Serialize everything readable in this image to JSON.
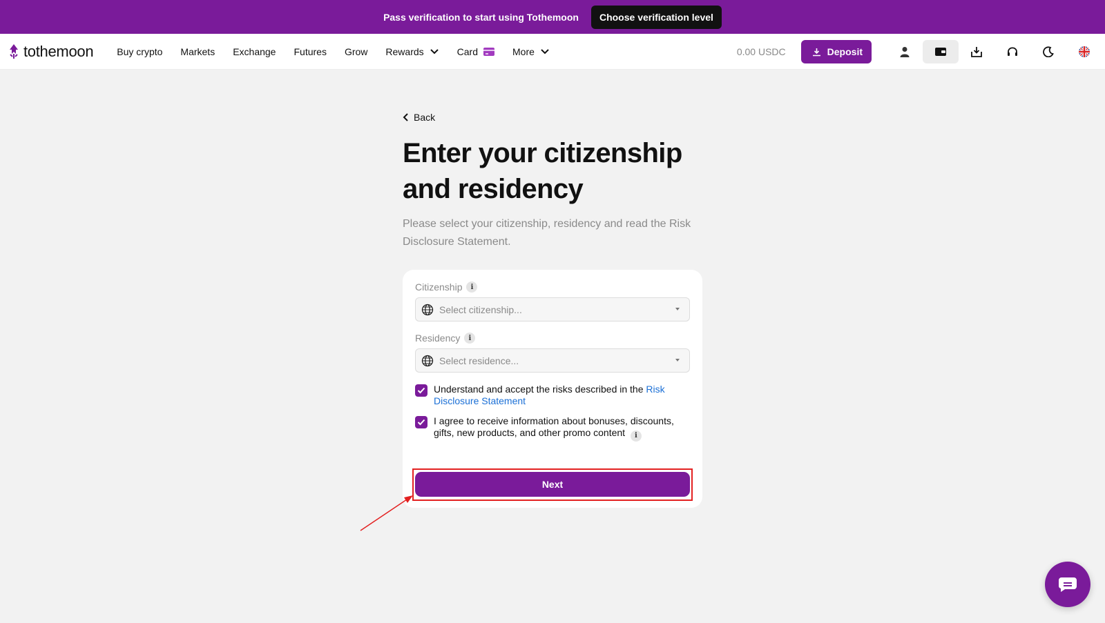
{
  "banner": {
    "text": "Pass verification to start using Tothemoon",
    "button_label": "Choose verification level"
  },
  "header": {
    "logo_text": "tothemoon",
    "nav": [
      {
        "label": "Buy crypto"
      },
      {
        "label": "Markets"
      },
      {
        "label": "Exchange"
      },
      {
        "label": "Futures"
      },
      {
        "label": "Grow"
      },
      {
        "label": "Rewards",
        "icon": "chevron-down-icon"
      },
      {
        "label": "Card",
        "icon": "card-icon"
      },
      {
        "label": "More",
        "icon": "chevron-down-icon"
      }
    ],
    "balance": "0.00 USDC",
    "deposit_label": "Deposit",
    "icons": [
      "user-icon",
      "wallet-icon",
      "download-icon",
      "headset-icon",
      "moon-icon",
      "uk-flag-icon"
    ]
  },
  "page": {
    "back_label": "Back",
    "title": "Enter your citizenship and residency",
    "subtitle": "Please select your citizenship, residency and read the Risk Disclosure Statement."
  },
  "form": {
    "citizenship": {
      "label": "Citizenship",
      "placeholder": "Select citizenship..."
    },
    "residency": {
      "label": "Residency",
      "placeholder": "Select residence..."
    },
    "checkbox_risk": {
      "checked": true,
      "text": "Understand and accept the risks described in the ",
      "link_text": "Risk Disclosure Statement"
    },
    "checkbox_promo": {
      "checked": true,
      "text": "I agree to receive information about bonuses, discounts, gifts, new products, and other promo content"
    },
    "next_label": "Next"
  },
  "colors": {
    "brand": "#7a1b9a",
    "link": "#1a6fd6",
    "annotation": "#e32020"
  }
}
